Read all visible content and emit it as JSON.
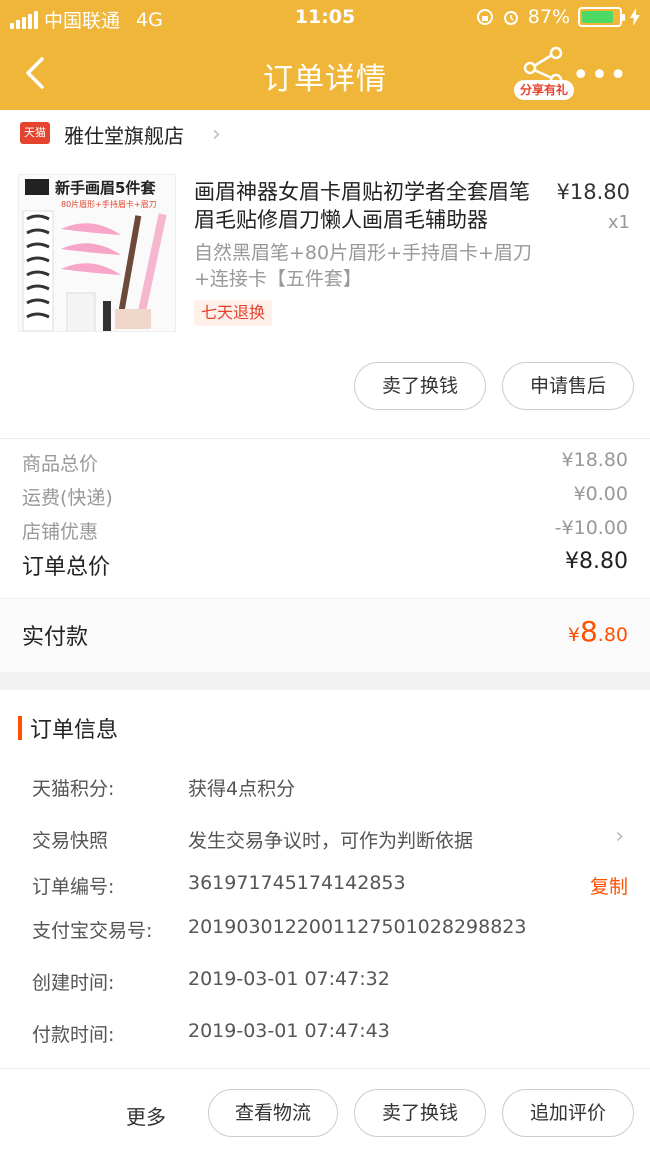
{
  "status_bar": {
    "carrier": "中国联通",
    "network": "4G",
    "time": "11:05",
    "battery": "87%",
    "battery_level": 0.87
  },
  "header": {
    "title": "订单详情",
    "share_label": "分享有礼",
    "more": "•••"
  },
  "shop": {
    "tmall_label": "天猫",
    "name": "雅仕堂旗舰店"
  },
  "item": {
    "image_title": "新手画眉5件套",
    "image_subtitle": "80片眉形+手持眉卡+眉刀",
    "name": "画眉神器女眉卡眉贴初学者全套眉笔眉毛贴修眉刀懒人画眉毛辅助器",
    "price": "¥18.80",
    "quantity": "x1",
    "spec": "自然黑眉笔+80片眉形+手持眉卡+眉刀+连接卡【五件套】",
    "badge": "七天退换"
  },
  "item_actions": {
    "sell": "卖了换钱",
    "after_sale": "申请售后"
  },
  "totals": {
    "goods_label": "商品总价",
    "goods_value": "¥18.80",
    "shipping_label": "运费(快递)",
    "shipping_value": "¥0.00",
    "discount_label": "店铺优惠",
    "discount_value": "-¥10.00",
    "total_label": "订单总价",
    "total_value": "¥8.80"
  },
  "paid": {
    "label": "实付款",
    "currency": "¥",
    "int": "8",
    "dec": ".80"
  },
  "order_info": {
    "title": "订单信息",
    "points_label": "天猫积分:",
    "points_value": "获得4点积分",
    "snapshot_label": "交易快照",
    "snapshot_value": "发生交易争议时，可作为判断依据",
    "order_no_label": "订单编号:",
    "order_no_value": "361971745174142853",
    "copy_label": "复制",
    "alipay_label": "支付宝交易号:",
    "alipay_value": "2019030122001127501028298823",
    "created_label": "创建时间:",
    "created_value": "2019-03-01 07:47:32",
    "paid_label": "付款时间:",
    "paid_value": "2019-03-01 07:47:43"
  },
  "footer": {
    "more": "更多",
    "logistics": "查看物流",
    "sell": "卖了换钱",
    "review": "追加评价"
  }
}
